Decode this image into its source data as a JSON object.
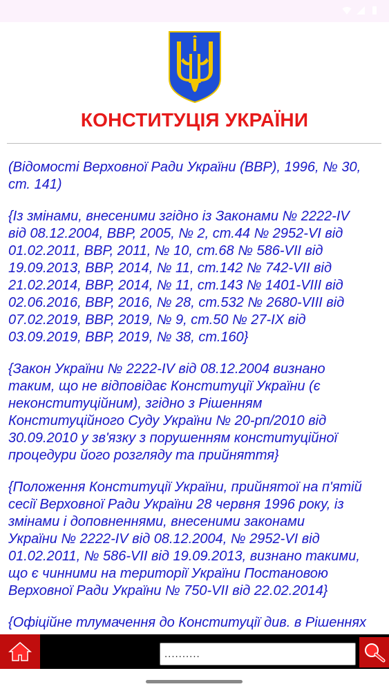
{
  "header": {
    "title": "КОНСТИТУЦІЯ УКРАЇНИ"
  },
  "content": {
    "paragraphs": [
      {
        "lines": [
          "(Відомості Верховної Ради України (ВВР), 1996, № 30,",
          "ст. 141)"
        ]
      },
      {
        "lines": [
          "{Із змінами, внесеними згідно із Законами № 2222-IV",
          "від 08.12.2004, ВВР, 2005, № 2, ст.44 № 2952-VI від",
          "01.02.2011, ВВР, 2011, № 10, ст.68 № 586-VII від",
          "19.09.2013, ВВР, 2014, № 11, ст.142 № 742-VII від",
          "21.02.2014, ВВР, 2014, № 11, ст.143 № 1401-VIII від",
          "02.06.2016, ВВР, 2016, № 28, ст.532 № 2680-VIII від",
          "07.02.2019, ВВР, 2019, № 9, ст.50 № 27-IX від",
          "03.09.2019, ВВР, 2019, № 38, ст.160}"
        ]
      },
      {
        "lines": [
          "{Закон України № 2222-IV від 08.12.2004 визнано",
          "таким, що не відповідає Конституції України (є",
          "неконституційним), згідно з Рішенням",
          "Конституційного Суду України № 20-рп/2010 від",
          "30.09.2010 у зв'язку з порушенням конституційної",
          "процедури його розгляду та прийняття}"
        ]
      },
      {
        "lines": [
          "{Положення Конституції України, прийнятої на п'ятій",
          "сесії Верховної Ради України 28 червня 1996 року, із",
          "змінами і доповненнями, внесеними законами",
          "України № 2222-IV від 08.12.2004, № 2952-VI від",
          "01.02.2011, № 586-VII від 19.09.2013, визнано такими,",
          "що є чинними на території України Постановою",
          "Верховної Ради України № 750-VII від 22.02.2014}"
        ]
      },
      {
        "lines": [
          "{Офіційне тлумачення до Конституції див. в Рішеннях"
        ]
      }
    ]
  },
  "bottom_bar": {
    "home_icon": "home-icon",
    "search_placeholder": "..........",
    "search_icon": "magnifier-icon"
  },
  "colors": {
    "title": "#e61919",
    "text": "#1919c8",
    "button_bg": "#c00d0d",
    "bar_bg": "#000000"
  }
}
